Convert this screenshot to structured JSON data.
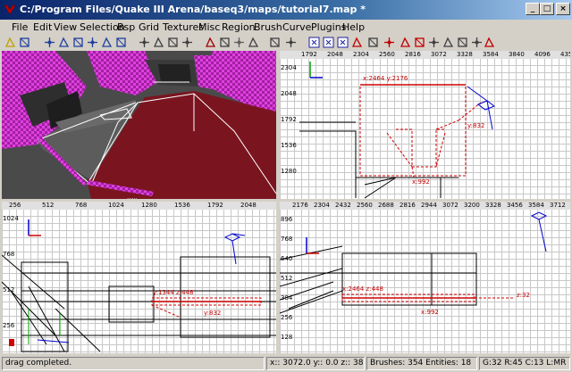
{
  "window": {
    "title": "C:/Program Files/Quake III Arena/baseq3/maps/tutorial7.map *"
  },
  "menu": [
    "File",
    "Edit",
    "View",
    "Selection",
    "Bsp",
    "Grid",
    "Textures",
    "Misc",
    "Region",
    "Brush",
    "Curve",
    "Plugins",
    "Help"
  ],
  "toolbar_icons": [
    "open-icon",
    "save-icon",
    "flip-x-icon",
    "flip-y-icon",
    "flip-z-icon",
    "rotate-x-icon",
    "rotate-y-icon",
    "rotate-z-icon",
    "select-complete-tall-icon",
    "select-touching-icon",
    "select-partial-tall-icon",
    "select-inside-icon",
    "csg-subtract-icon",
    "csg-merge-icon",
    "make-hollow-icon",
    "clipper-icon",
    "change-view-icon",
    "texture-view-icon",
    "view-x-icon",
    "view-y-icon",
    "view-z-icon",
    "cubic-clip-icon",
    "camera-view-icon",
    "entity-view-icon",
    "move-icon",
    "paint-icon",
    "show-bounds-icon",
    "free-rotate-icon",
    "scale-icon",
    "patch-icon",
    "plugin-icon"
  ],
  "top_right_view": {
    "ruler_x": [
      "1792",
      "2048",
      "2304",
      "2560",
      "2816",
      "3072",
      "3328",
      "3584",
      "3840",
      "4096",
      "435"
    ],
    "ruler_y": [
      "2304",
      "2048",
      "1792",
      "1536",
      "1280"
    ],
    "labels": {
      "coords": "x:2464 y:2176",
      "y_size": "y:832",
      "x_size": "x:992"
    }
  },
  "bottom_left_view": {
    "ruler_x": [
      "256",
      "512",
      "768",
      "1024",
      "1280",
      "1536",
      "1792",
      "2048"
    ],
    "ruler_y": [
      "1024",
      "768",
      "512",
      "256"
    ],
    "labels": {
      "coords": "y:1344 z:448",
      "y_size": "y:832"
    }
  },
  "bottom_right_view": {
    "ruler_x": [
      "2176",
      "2304",
      "2432",
      "2560",
      "2688",
      "2816",
      "2944",
      "3072",
      "3200",
      "3328",
      "3456",
      "3584",
      "3712"
    ],
    "ruler_y": [
      "896",
      "768",
      "640",
      "512",
      "384",
      "256",
      "128"
    ],
    "labels": {
      "coords": "x:2464 z:448",
      "z_size": "z:32",
      "x_size": "x:992"
    }
  },
  "status": {
    "message": "drag completed.",
    "position": "x:: 3072.0  y:: 0.0  z:: 384.0",
    "counts": "Brushes: 354 Entities: 18",
    "grid": "G:32 R:45 C:13 L:MR"
  }
}
